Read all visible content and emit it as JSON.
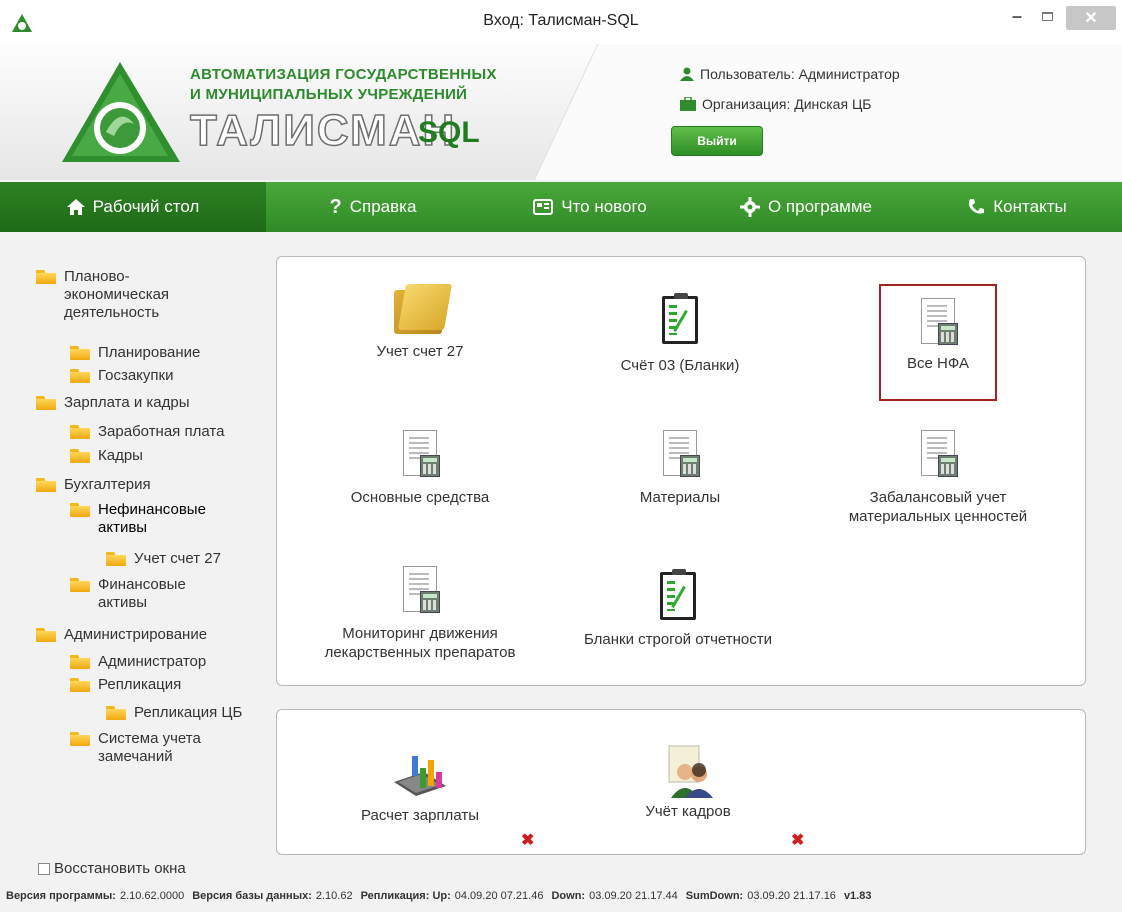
{
  "window": {
    "title": "Вход: Талисман-SQL"
  },
  "header": {
    "brand_line1": "АВТОМАТИЗАЦИЯ ГОСУДАРСТВЕННЫХ",
    "brand_line2": "И  МУНИЦИПАЛЬНЫХ  УЧРЕЖДЕНИЙ",
    "brand_name": "ТАЛИСМАН",
    "brand_sql": "SQL",
    "user_label": "Пользователь: Администратор",
    "org_label": "Организация: Динская ЦБ",
    "logout_label": "Выйти"
  },
  "nav": [
    {
      "label": "Рабочий стол",
      "icon": "home-icon"
    },
    {
      "label": "Справка",
      "icon": "question-icon"
    },
    {
      "label": "Что нового",
      "icon": "news-icon"
    },
    {
      "label": "О программе",
      "icon": "gear-icon"
    },
    {
      "label": "Контакты",
      "icon": "phone-icon"
    }
  ],
  "tree": [
    {
      "label": "Планово-\nэкономическая\nдеятельность"
    },
    {
      "label": "Планирование"
    },
    {
      "label": "Госзакупки"
    },
    {
      "label": "Зарплата и кадры"
    },
    {
      "label": "Заработная плата"
    },
    {
      "label": "Кадры"
    },
    {
      "label": "Бухгалтерия"
    },
    {
      "label": "Нефинансовые\nактивы"
    },
    {
      "label": "Учет счет 27"
    },
    {
      "label": "Финансовые\nактивы"
    },
    {
      "label": "Администрирование"
    },
    {
      "label": "Администратор"
    },
    {
      "label": "Репликация"
    },
    {
      "label": "Репликация ЦБ"
    },
    {
      "label": "Система учета\nзамечаний"
    }
  ],
  "restore_windows": "Восстановить окна",
  "tiles": [
    {
      "label": "Учет счет 27",
      "icon": "folder-icon"
    },
    {
      "label": "Счёт 03 (Бланки)",
      "icon": "clipboard-icon"
    },
    {
      "label": "Все НФА",
      "icon": "document-calculator-icon"
    },
    {
      "label": "Основные средства",
      "icon": "document-calculator-icon"
    },
    {
      "label": "Материалы",
      "icon": "document-calculator-icon"
    },
    {
      "label": "Забалансовый учет\nматериальных ценностей",
      "icon": "document-calculator-icon"
    },
    {
      "label": "Мониторинг движения\nлекарственных препаратов",
      "icon": "document-calculator-icon"
    },
    {
      "label": "Бланки строгой отчетности",
      "icon": "clipboard-icon"
    }
  ],
  "bottom_tiles": [
    {
      "label": "Расчет зарплаты",
      "icon": "calculator-chart-icon"
    },
    {
      "label": "Учёт кадров",
      "icon": "personnel-icon"
    }
  ],
  "status": {
    "version_label": "Версия программы:",
    "version": "2.10.62.0000",
    "db_label": "Версия базы данных:",
    "db": "2.10.62",
    "repl_label": "Репликация: Up:",
    "up": "04.09.20 07.21.46",
    "down_label": "Down:",
    "down": "03.09.20 21.17.44",
    "sumdown_label": "SumDown:",
    "sumdown": "03.09.20 21.17.16",
    "build": "v1.83"
  },
  "colors": {
    "accent": "#3a9a2e",
    "selection": "#a32323",
    "remove": "#d21c1c"
  }
}
